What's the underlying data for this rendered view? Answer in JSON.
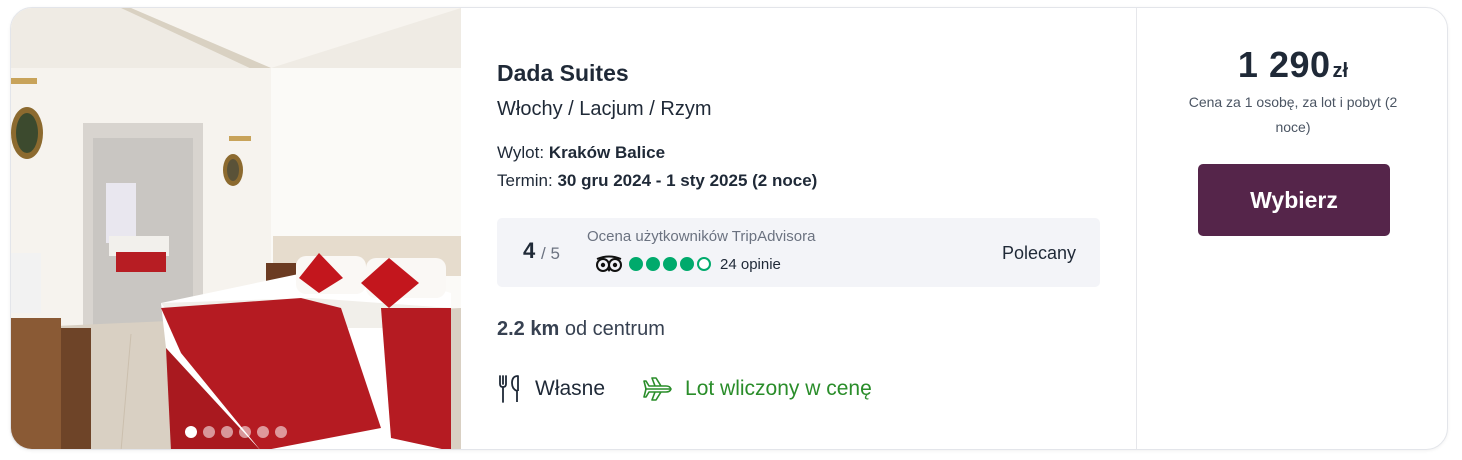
{
  "hotel": {
    "name": "Dada Suites",
    "location": "Włochy / Lacjum / Rzym"
  },
  "departure": {
    "label": "Wylot:",
    "value": "Kraków Balice"
  },
  "term": {
    "label": "Termin:",
    "value": "30 gru 2024 - 1 sty 2025 (2 noce)"
  },
  "rating": {
    "score": "4",
    "max": "/ 5",
    "caption": "Ocena użytkowników TripAdvisora",
    "bubbles_filled": 4,
    "bubbles_total": 5,
    "reviews": "24 opinie",
    "badge": "Polecany",
    "brand_color": "#00aa6c"
  },
  "distance": {
    "value": "2.2 km",
    "suffix": "od centrum"
  },
  "amenities": {
    "board": {
      "icon": "fork-knife-icon",
      "label": "Własne"
    },
    "flight": {
      "icon": "airplane-icon",
      "label": "Lot wliczony w cenę",
      "color": "#2a8d2a"
    }
  },
  "price": {
    "amount": "1 290",
    "currency": "zł",
    "note": "Cena za 1 osobę, za lot i pobyt (2 noce)"
  },
  "cta": {
    "label": "Wybierz",
    "color": "#55254a"
  },
  "gallery": {
    "photo_count": 6,
    "active_index": 0
  }
}
